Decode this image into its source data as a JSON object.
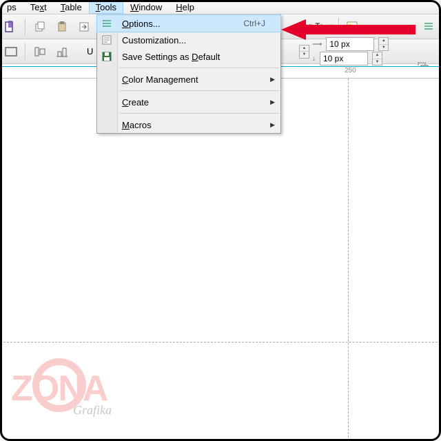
{
  "menubar": {
    "items": [
      {
        "label": "ps"
      },
      {
        "label": "Text",
        "u": 2
      },
      {
        "label": "Table",
        "u": 0
      },
      {
        "label": "Tools",
        "u": 0,
        "open": true
      },
      {
        "label": "Window",
        "u": 0
      },
      {
        "label": "Help",
        "u": 0
      }
    ]
  },
  "dropdown": {
    "items": [
      {
        "label": "Options...",
        "u": 0,
        "shortcut": "Ctrl+J",
        "highlight": true,
        "icon": "options-icon"
      },
      {
        "label": "Customization...",
        "icon": "customize-icon"
      },
      {
        "label": "Save Settings as Default",
        "u": 17,
        "icon": "save-icon"
      },
      {
        "divider": true
      },
      {
        "label": "Color Management",
        "u": 0,
        "submenu": true
      },
      {
        "divider": true
      },
      {
        "label": "Create",
        "u": 0,
        "submenu": true
      },
      {
        "divider": true
      },
      {
        "label": "Macros",
        "u": 0,
        "submenu": true
      }
    ]
  },
  "toolbar2": {
    "placeholder": "U"
  },
  "snap": {
    "label": "nap To",
    "px1": "10 px",
    "px2": "10 px"
  },
  "ruler": {
    "mark": "250"
  },
  "watermark": {
    "main": "ZONA",
    "sub": "Grafika"
  }
}
